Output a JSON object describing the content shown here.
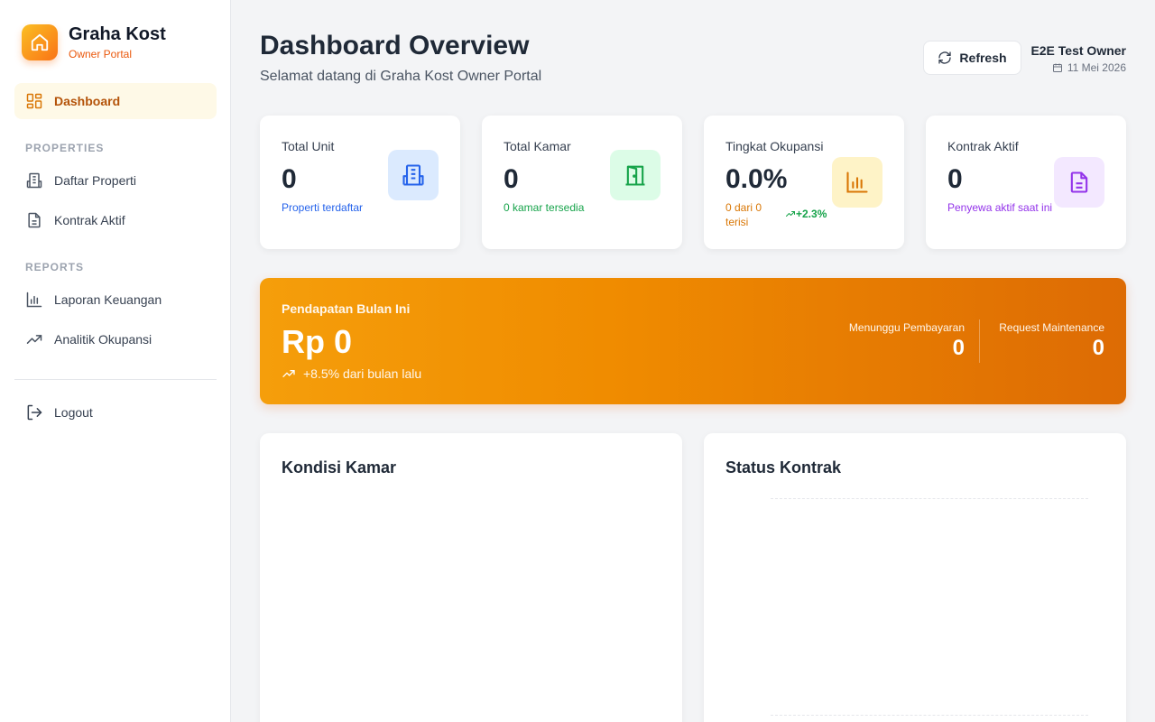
{
  "brand": {
    "title": "Graha Kost",
    "subtitle": "Owner Portal"
  },
  "sidebar": {
    "dashboard": "Dashboard",
    "properties_section": "PROPERTIES",
    "daftar_properti": "Daftar Properti",
    "kontrak_aktif": "Kontrak Aktif",
    "reports_section": "REPORTS",
    "laporan_keuangan": "Laporan Keuangan",
    "analitik_okupansi": "Analitik Okupansi",
    "logout": "Logout"
  },
  "header": {
    "title": "Dashboard Overview",
    "subtitle": "Selamat datang di Graha Kost Owner Portal",
    "refresh": "Refresh",
    "user_name": "E2E Test Owner",
    "date": "11 Mei 2026"
  },
  "stats": [
    {
      "label": "Total Unit",
      "value": "0",
      "sub": "Properti terdaftar",
      "color": "#2563eb",
      "icon": "building-icon"
    },
    {
      "label": "Total Kamar",
      "value": "0",
      "sub": "0 kamar tersedia",
      "color": "#16a34a",
      "icon": "door-icon"
    },
    {
      "label": "Tingkat Okupansi",
      "value": "0.0%",
      "sub": "0 dari 0 terisi",
      "trend": "+2.3%",
      "color": "#d97706",
      "icon": "bar-chart-icon"
    },
    {
      "label": "Kontrak Aktif",
      "value": "0",
      "sub": "Penyewa aktif saat ini",
      "color": "#9333ea",
      "icon": "document-icon"
    }
  ],
  "revenue": {
    "label": "Pendapatan Bulan Ini",
    "value": "Rp 0",
    "change": "+8.5% dari bulan lalu",
    "pending_label": "Menunggu Pembayaran",
    "pending_value": "0",
    "maintenance_label": "Request Maintenance",
    "maintenance_value": "0"
  },
  "panels": {
    "kondisi_kamar": "Kondisi Kamar",
    "status_kontrak": "Status Kontrak"
  }
}
